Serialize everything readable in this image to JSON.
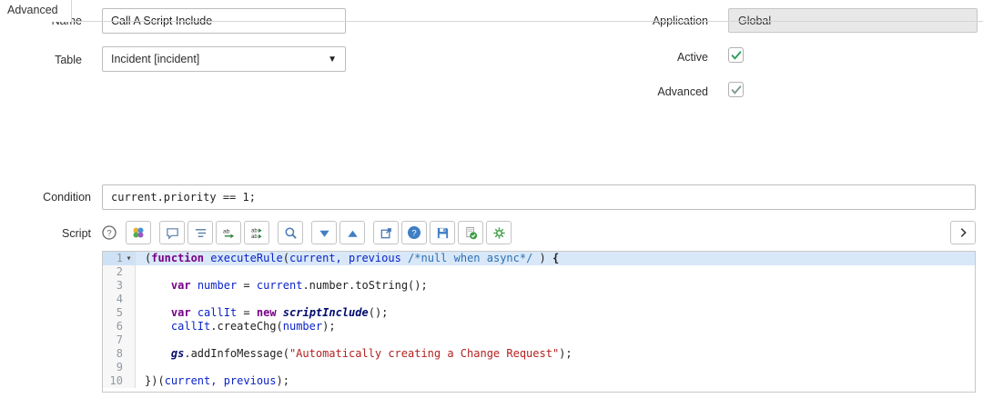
{
  "fields": {
    "name": {
      "label": "Name",
      "value": "Call A Script Include"
    },
    "table": {
      "label": "Table",
      "value": "Incident [incident]",
      "caret_icon": "caret-down-icon"
    },
    "application": {
      "label": "Application",
      "value": "Global",
      "readonly": true
    },
    "active": {
      "label": "Active",
      "checked": true,
      "check_color": "#2e9e5b"
    },
    "advanced": {
      "label": "Advanced",
      "checked": true,
      "check_color": "#7d9b8a"
    }
  },
  "tab": {
    "label": "Advanced",
    "active": true
  },
  "condition": {
    "label": "Condition",
    "value": "current.priority == 1;"
  },
  "script_section": {
    "label": "Script",
    "help_icon": "help-circle-icon",
    "toolbar_groups": [
      {
        "buttons": [
          "syntax-highlight-icon"
        ]
      },
      {
        "buttons": [
          "comment-icon",
          "format-code-icon",
          "replace-icon",
          "replace-all-icon"
        ]
      },
      {
        "buttons": [
          "search-icon"
        ]
      },
      {
        "buttons": [
          "fold-all-icon",
          "unfold-all-icon"
        ]
      },
      {
        "buttons": [
          "open-window-icon",
          "help-filled-icon",
          "save-icon",
          "syntax-check-icon",
          "script-debug-icon"
        ]
      }
    ],
    "expand_icon": "chevron-right-icon"
  },
  "editor": {
    "active_line": 1,
    "fold_marker_icon": "fold-marker-icon",
    "lines": [
      {
        "n": 1,
        "fold": true,
        "tokens": [
          [
            "p",
            "("
          ],
          [
            "kw",
            "function"
          ],
          [
            "p",
            " "
          ],
          [
            "def",
            "executeRule"
          ],
          [
            "p",
            "("
          ],
          [
            "var",
            "current, previous"
          ],
          [
            "p",
            " "
          ],
          [
            "com",
            "/*null when async*/"
          ],
          [
            "p",
            " ) "
          ],
          [
            "brace",
            "{"
          ]
        ]
      },
      {
        "n": 2,
        "tokens": []
      },
      {
        "n": 3,
        "tokens": [
          [
            "p",
            "    "
          ],
          [
            "kw",
            "var"
          ],
          [
            "p",
            " "
          ],
          [
            "def",
            "number"
          ],
          [
            "p",
            " = "
          ],
          [
            "var",
            "current"
          ],
          [
            "p",
            ".number.toString();"
          ]
        ]
      },
      {
        "n": 4,
        "tokens": []
      },
      {
        "n": 5,
        "tokens": [
          [
            "p",
            "    "
          ],
          [
            "kw",
            "var"
          ],
          [
            "p",
            " "
          ],
          [
            "def",
            "callIt"
          ],
          [
            "p",
            " = "
          ],
          [
            "kw",
            "new"
          ],
          [
            "p",
            " "
          ],
          [
            "cls",
            "scriptInclude"
          ],
          [
            "p",
            "();"
          ]
        ]
      },
      {
        "n": 6,
        "tokens": [
          [
            "p",
            "    "
          ],
          [
            "var",
            "callIt"
          ],
          [
            "p",
            ".createChg("
          ],
          [
            "var",
            "number"
          ],
          [
            "p",
            ");"
          ]
        ]
      },
      {
        "n": 7,
        "tokens": []
      },
      {
        "n": 8,
        "tokens": [
          [
            "p",
            "    "
          ],
          [
            "cls",
            "gs"
          ],
          [
            "p",
            ".addInfoMessage("
          ],
          [
            "str",
            "\"Automatically creating a Change Request\""
          ],
          [
            "p",
            ");"
          ]
        ]
      },
      {
        "n": 9,
        "tokens": []
      },
      {
        "n": 10,
        "tokens": [
          [
            "p",
            "})("
          ],
          [
            "var",
            "current, previous"
          ],
          [
            "p",
            ");"
          ]
        ]
      }
    ]
  }
}
